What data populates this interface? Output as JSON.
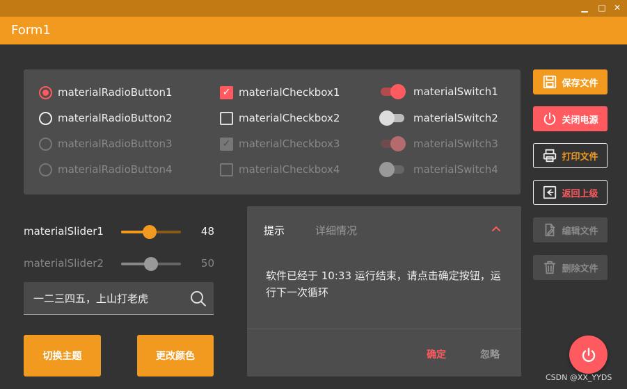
{
  "window": {
    "title": "Form1",
    "minimize_glyph": "▁",
    "maximize_glyph": "□",
    "close_glyph": "✕"
  },
  "colors": {
    "accent": "#f19a1f",
    "accent_dark": "#c27a14",
    "danger": "#ff5a5f",
    "background": "#333333",
    "panel": "#4d4d4d"
  },
  "radios": [
    {
      "label": "materialRadioButton1",
      "checked": true,
      "enabled": true
    },
    {
      "label": "materialRadioButton2",
      "checked": false,
      "enabled": true
    },
    {
      "label": "materialRadioButton3",
      "checked": false,
      "enabled": false
    },
    {
      "label": "materialRadioButton4",
      "checked": false,
      "enabled": false
    }
  ],
  "checkboxes": [
    {
      "label": "materialCheckbox1",
      "checked": true,
      "enabled": true
    },
    {
      "label": "materialCheckbox2",
      "checked": false,
      "enabled": true
    },
    {
      "label": "materialCheckbox3",
      "checked": true,
      "enabled": false
    },
    {
      "label": "materialCheckbox4",
      "checked": false,
      "enabled": false
    }
  ],
  "switches": [
    {
      "label": "materialSwitch1",
      "on": true,
      "enabled": true
    },
    {
      "label": "materialSwitch2",
      "on": false,
      "enabled": true
    },
    {
      "label": "materialSwitch3",
      "on": true,
      "enabled": false
    },
    {
      "label": "materialSwitch4",
      "on": false,
      "enabled": false
    }
  ],
  "side_buttons": [
    {
      "label": "保存文件",
      "icon": "floppy-disk-icon"
    },
    {
      "label": "关闭电源",
      "icon": "power-icon"
    },
    {
      "label": "打印文件",
      "icon": "printer-icon"
    },
    {
      "label": "返回上级",
      "icon": "back-arrow-icon"
    },
    {
      "label": "编辑文件",
      "icon": "edit-document-icon",
      "enabled": false
    },
    {
      "label": "删除文件",
      "icon": "trash-icon",
      "enabled": false
    }
  ],
  "sliders": [
    {
      "label": "materialSlider1",
      "value": 48,
      "max": 100,
      "enabled": true
    },
    {
      "label": "materialSlider2",
      "value": 50,
      "max": 100,
      "enabled": false
    }
  ],
  "search": {
    "value": "一二三四五，上山打老虎",
    "icon": "search-icon"
  },
  "buttons": {
    "switch_theme": "切换主题",
    "change_color": "更改颜色"
  },
  "dialog": {
    "tab_hint": "提示",
    "tab_details": "详细情况",
    "message": "软件已经于 10:33 运行结束，请点击确定按钮，运行下一次循环",
    "confirm": "确定",
    "ignore": "忽略"
  },
  "fab": {
    "icon": "power-icon"
  },
  "watermark": "CSDN @XX_YYDS"
}
